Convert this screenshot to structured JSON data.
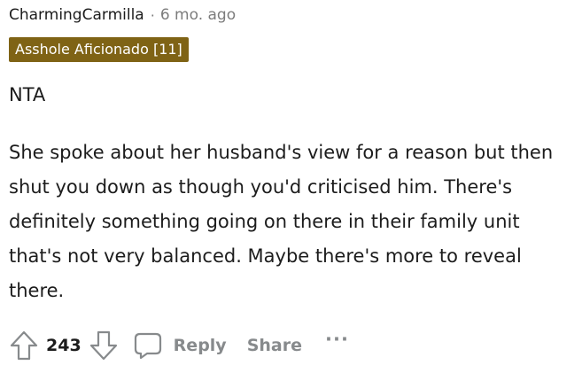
{
  "comment": {
    "author": "CharmingCarmilla",
    "separator": "·",
    "timestamp": "6 mo. ago",
    "flair": {
      "text": "Asshole Aficionado [11]",
      "background": "#7f6315",
      "color": "#ffffff"
    },
    "body": {
      "verdict": "NTA",
      "paragraph": "She spoke about her husband's view for a reason but then shut you down as though you'd criticised him. There's definitely something going on there in their family unit that's not very balanced. Maybe there's more to reveal there."
    }
  },
  "actions": {
    "upvote_icon": "upvote-arrow-icon",
    "score": "243",
    "downvote_icon": "downvote-arrow-icon",
    "reply_icon": "speech-bubble-icon",
    "reply_label": "Reply",
    "share_label": "Share",
    "more_label": "···"
  },
  "colors": {
    "text_primary": "#1c1c1c",
    "text_meta": "#7c7c7c",
    "action_gray": "#878a8c",
    "icon_stroke": "#878a8c"
  }
}
